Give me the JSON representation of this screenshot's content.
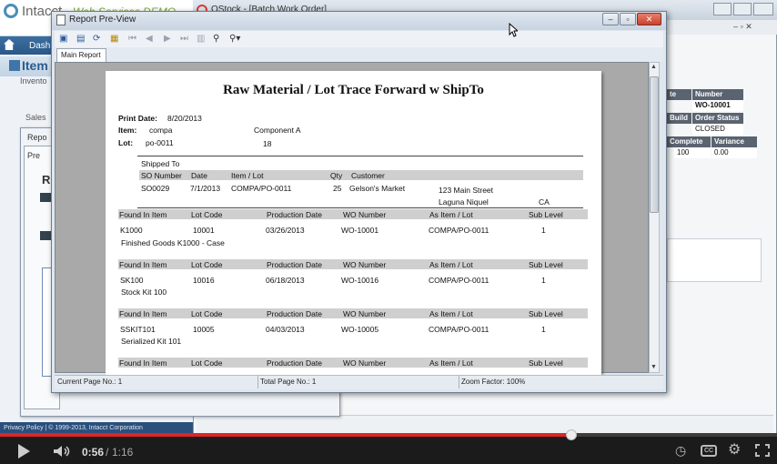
{
  "background_app": {
    "logo_text": "Intacct",
    "demo_label": "Web Services DEMO",
    "nav_item": "Dashb",
    "page_title": "Item I",
    "inventory_label": "Invento",
    "sales_label": "Sales",
    "footer_text": "Privacy Policy | © 1999-2013, Intacct Corporation",
    "mid_window": {
      "tab_label": "Repo",
      "sub_label": "Pre",
      "heading": "R"
    }
  },
  "qstock": {
    "title": "QStock - [Batch Work Order]",
    "grid": [
      {
        "header": "Number",
        "value": "WO-10001"
      },
      {
        "header": "Order Status",
        "value": "CLOSED"
      }
    ],
    "grid2": [
      {
        "header": "Complete",
        "value": "100"
      },
      {
        "header": "Variance",
        "value": "0.00"
      }
    ],
    "partial_labels": {
      "build": "Build",
      "te": "te"
    }
  },
  "preview": {
    "window_title": "Report Pre-View",
    "tab_label": "Main Report",
    "status": {
      "current_page": "Current Page No.: 1",
      "total_page": "Total Page No.: 1",
      "zoom": "Zoom Factor: 100%"
    }
  },
  "report": {
    "title": "Raw Material / Lot Trace Forward w ShipTo",
    "print_date_label": "Print Date:",
    "print_date": "8/20/2013",
    "item_label": "Item:",
    "item_value": "compa",
    "item_desc": "Component A",
    "lot_label": "Lot:",
    "lot_value": "po-0011",
    "lot_qty": "18",
    "shipped_to_label": "Shipped To",
    "ship_headers": [
      "SO Number",
      "Date",
      "Item / Lot",
      "Qty",
      "Customer"
    ],
    "ship_row": {
      "so": "SO0029",
      "date": "7/1/2013",
      "item_lot": "COMPA/PO-0011",
      "qty": "25",
      "customer": "Gelson's Market",
      "address1": "123 Main Street",
      "city": "Laguna Niquel",
      "state": "CA"
    },
    "headers": [
      "Found In Item",
      "Lot Code",
      "Production Date",
      "WO Number",
      "As Item / Lot",
      "Sub Level"
    ],
    "rows": [
      {
        "item": "K1000",
        "lot": "10001",
        "date": "03/26/2013",
        "wo": "WO-10001",
        "as_item": "COMPA/PO-0011",
        "level": "1",
        "desc": "Finished Goods K1000 - Case"
      },
      {
        "item": "SK100",
        "lot": "10016",
        "date": "06/18/2013",
        "wo": "WO-10016",
        "as_item": "COMPA/PO-0011",
        "level": "1",
        "desc": "Stock Kit 100"
      },
      {
        "item": "SSKIT101",
        "lot": "10005",
        "date": "04/03/2013",
        "wo": "WO-10005",
        "as_item": "COMPA/PO-0011",
        "level": "1",
        "desc": "Serialized Kit 101"
      }
    ]
  },
  "video": {
    "current_time": "0:56",
    "separator": "/",
    "duration": "1:16",
    "progress_fraction": 0.735,
    "cc_label": "CC",
    "accent_color": "#e02424"
  }
}
